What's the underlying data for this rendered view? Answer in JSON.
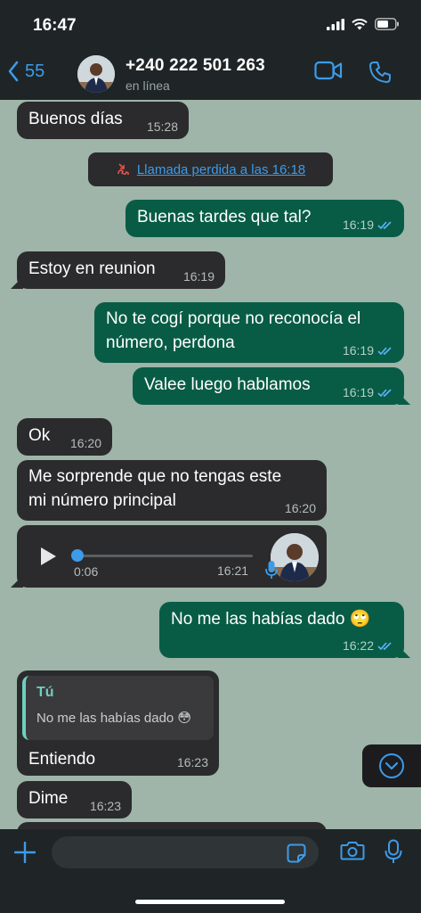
{
  "status_bar": {
    "time": "16:47"
  },
  "header": {
    "back_count": "55",
    "contact_name": "+240 222 501 263",
    "contact_status": "en línea"
  },
  "messages": [
    {
      "text": "Buenos días",
      "time": "15:28"
    },
    {
      "text": "Llamada perdida a las 16:18"
    },
    {
      "text": "Buenas tardes que tal?",
      "time": "16:19"
    },
    {
      "text": "Estoy en reunion",
      "time": "16:19"
    },
    {
      "line1": "No te cogí porque no reconocía el",
      "line2": "número, perdona",
      "time": "16:19"
    },
    {
      "text": "Valee luego hablamos",
      "time": "16:19"
    },
    {
      "text": "Ok",
      "time": "16:20"
    },
    {
      "line1": "Me sorprende que no tengas este",
      "line2": "mi número principal",
      "time": "16:20"
    },
    {
      "duration": "0:06",
      "time": "16:21",
      "progress": 0
    },
    {
      "text": "No me las habías dado 🙄",
      "time": "16:22"
    },
    {
      "quote_author": "Tú",
      "quote_text": "No me las habías dado 😳",
      "text": "Entiendo",
      "time": "16:23"
    },
    {
      "text": "Dime",
      "time": "16:23"
    }
  ],
  "input": {
    "placeholder": ""
  },
  "colors": {
    "accent": "#3d9be9",
    "outgoing": "#085c45",
    "incoming": "#2b2b2d",
    "wallpaper": "#9fb5a9"
  }
}
